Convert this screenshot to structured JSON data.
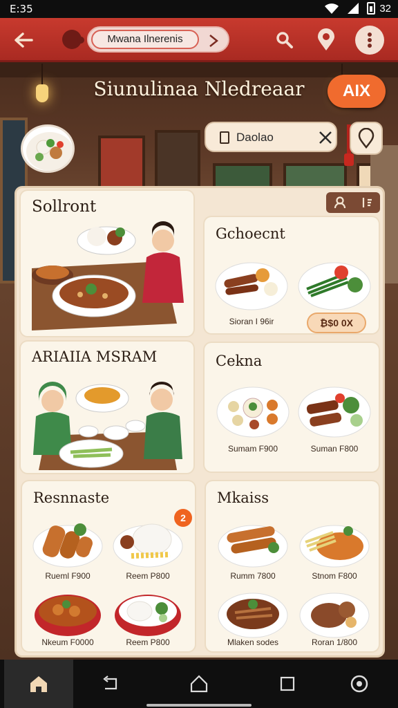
{
  "status_bar": {
    "time": "E:35",
    "battery_text": "32"
  },
  "app_bar": {
    "tag_label": "Mwana Ilnerenis"
  },
  "scene": {
    "title": "Siunulinaa Nledreaar",
    "ai_button": "AIX"
  },
  "search_chip": {
    "text": "Daolao"
  },
  "panel": {
    "cards": [
      {
        "title": "Sollront"
      },
      {
        "title": "Gchoecnt",
        "dishes": [
          {
            "label": "Sioran I 96ir"
          }
        ],
        "price_button": "₿$0 0X"
      },
      {
        "title": "ARIAIIA MSRAM"
      },
      {
        "title": "Cekna",
        "dishes": [
          {
            "label": "Sumam F900"
          },
          {
            "label": "Suman F800"
          }
        ]
      },
      {
        "title": "Resnnaste",
        "badge": "2",
        "dishes": [
          {
            "label": "Rueml F900"
          },
          {
            "label": "Reem P800"
          },
          {
            "label": "Nkeum F0000"
          },
          {
            "label": "Reem P800"
          }
        ]
      },
      {
        "title": "Mkaiss",
        "dishes": [
          {
            "label": "Rumm 7800"
          },
          {
            "label": "Stnom F800"
          },
          {
            "label": "Mlaken sodes"
          },
          {
            "label": "Roran 1/800"
          }
        ]
      }
    ]
  },
  "colors": {
    "accent": "#c83a2e",
    "ai_button": "#f06b2e",
    "panel": "#f4e6d3",
    "card": "#fbf5e9"
  },
  "icons": [
    "back-arrow-icon",
    "app-logo-icon",
    "search-icon",
    "location-pin-icon",
    "more-vert-icon",
    "document-icon",
    "close-icon",
    "map-pin-icon",
    "person-icon",
    "sort-icon",
    "home-icon",
    "back-icon",
    "home-circle-icon",
    "recents-icon",
    "assistant-icon"
  ]
}
